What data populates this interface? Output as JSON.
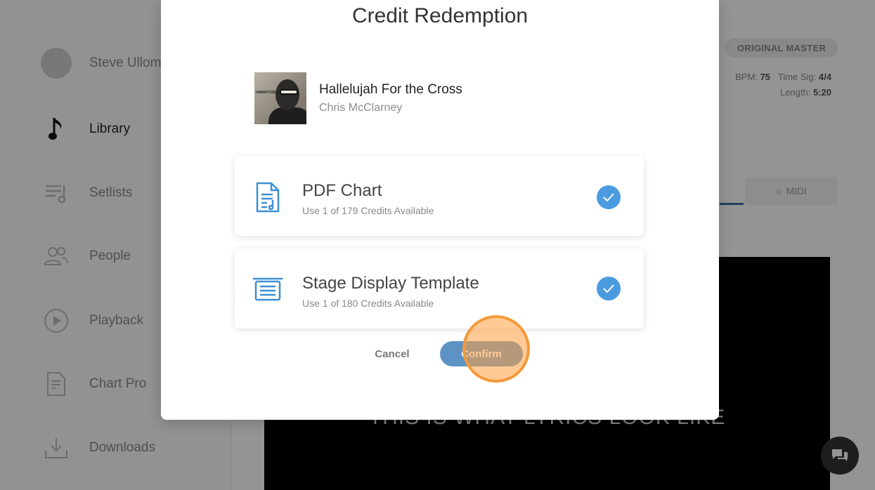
{
  "sidebar": {
    "items": [
      {
        "label": "Steve Ullom",
        "icon": "avatar"
      },
      {
        "label": "Library",
        "icon": "music-note-icon"
      },
      {
        "label": "Setlists",
        "icon": "setlist-icon"
      },
      {
        "label": "People",
        "icon": "people-icon"
      },
      {
        "label": "Playback",
        "icon": "play-icon"
      },
      {
        "label": "Chart Pro",
        "icon": "chart-pro-icon"
      },
      {
        "label": "Downloads",
        "icon": "download-icon"
      }
    ]
  },
  "song_info": {
    "badge": "ORIGINAL MASTER",
    "bpm_label": "BPM:",
    "bpm": "75",
    "time_sig_label": "Time Sig:",
    "time_sig": "4/4",
    "length_label": "Length:",
    "length": "5:20",
    "midi_tab": "MIDI"
  },
  "preview": {
    "lyrics": "THIS IS WHAT LYRICS LOOK LIKE"
  },
  "modal": {
    "title": "Credit Redemption",
    "song_title": "Hallelujah For the Cross",
    "song_artist": "Chris McClarney",
    "cover_text": "UNMATCHED",
    "options": [
      {
        "title": "PDF Chart",
        "subtitle": "Use 1 of 179 Credits Available",
        "checked": true
      },
      {
        "title": "Stage Display Template",
        "subtitle": "Use 1 of 180 Credits Available",
        "checked": true
      }
    ],
    "cancel_label": "Cancel",
    "confirm_label": "Confirm"
  },
  "colors": {
    "accent": "#4a9be0",
    "confirm": "#5d93c4",
    "click_marker": "#f39a3b"
  }
}
